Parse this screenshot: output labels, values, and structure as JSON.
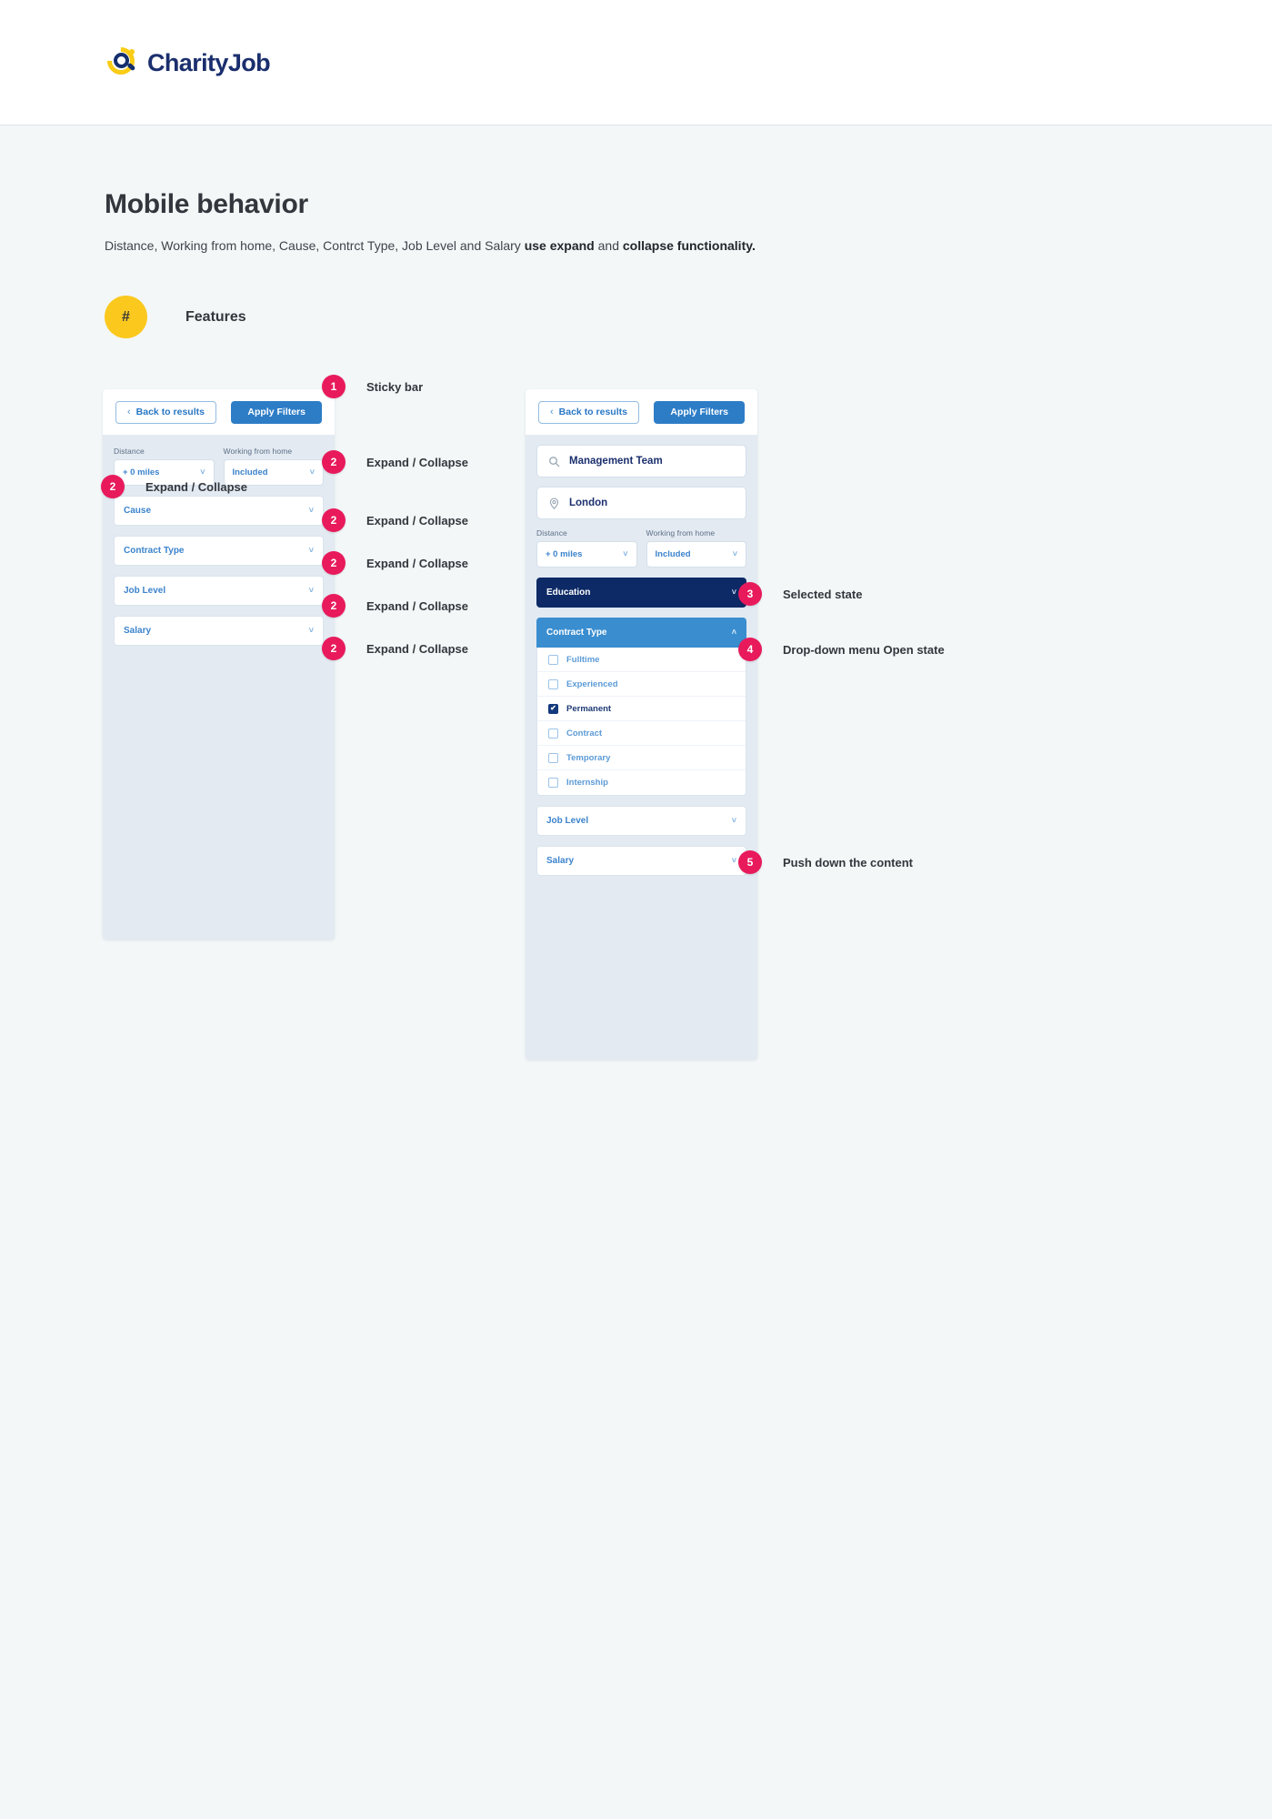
{
  "header": {
    "logo_text": "CharityJob",
    "logo_icon": "charityjob-magnifier-logo"
  },
  "title": "Mobile behavior",
  "subtitle": {
    "part1": "Distance, Working from home, Cause, Contrct Type, Job Level and Salary ",
    "bold1": "use expand",
    "part2": " and ",
    "bold2": "collapse functionality."
  },
  "features": {
    "hash": "#",
    "label": "Features"
  },
  "colors": {
    "page_bg": "#f3f7f8",
    "mock_bg": "#e3eaf2",
    "accent_pink": "#e81a5c",
    "brand_navy": "#0d2a66",
    "brand_blue": "#2d7dc6",
    "selected_blue": "#3a8ed0",
    "badge_yellow": "#fbc81e"
  },
  "sticky_bar": {
    "back_label": "Back to results",
    "back_icon": "chevron-left-icon",
    "apply_label": "Apply Filters"
  },
  "left_mock": {
    "distance": {
      "label": "Distance",
      "value": "+ 0 miles",
      "icon": "chevron-down-icon"
    },
    "wfh": {
      "label": "Working from home",
      "value": "Included",
      "icon": "chevron-down-icon"
    },
    "accordions": [
      {
        "label": "Cause",
        "icon": "chevron-down-icon"
      },
      {
        "label": "Contract Type",
        "icon": "chevron-down-icon"
      },
      {
        "label": "Job Level",
        "icon": "chevron-down-icon"
      },
      {
        "label": "Salary",
        "icon": "chevron-down-icon"
      }
    ],
    "overlay_label": "Expand / Collapse"
  },
  "right_mock": {
    "keyword": {
      "value": "Management Team",
      "icon": "search-icon"
    },
    "location": {
      "value": "London",
      "icon": "location-pin-icon"
    },
    "distance": {
      "label": "Distance",
      "value": "+ 0 miles",
      "icon": "chevron-down-icon"
    },
    "wfh": {
      "label": "Working from home",
      "value": "Included",
      "icon": "chevron-down-icon"
    },
    "education": {
      "label": "Education",
      "icon": "chevron-down-icon",
      "state": "selected"
    },
    "contract_type": {
      "label": "Contract Type",
      "icon": "chevron-up-icon",
      "state": "open"
    },
    "contract_options": [
      {
        "label": "Fulltime",
        "checked": false
      },
      {
        "label": "Experienced",
        "checked": false
      },
      {
        "label": "Permanent",
        "checked": true
      },
      {
        "label": "Contract",
        "checked": false
      },
      {
        "label": "Temporary",
        "checked": false
      },
      {
        "label": "Internship",
        "checked": false
      }
    ],
    "check_glyph": "✔",
    "accordions": [
      {
        "label": "Job Level",
        "icon": "chevron-down-icon"
      },
      {
        "label": "Salary",
        "icon": "chevron-down-icon"
      }
    ]
  },
  "annotations": [
    {
      "num": "1",
      "text": "Sticky bar"
    },
    {
      "num": "2",
      "text": "Expand / Collapse"
    },
    {
      "num": "2",
      "text": "Expand / Collapse"
    },
    {
      "num": "2",
      "text": "Expand / Collapse"
    },
    {
      "num": "2",
      "text": "Expand / Collapse"
    },
    {
      "num": "2",
      "text": "Expand / Collapse"
    },
    {
      "num": "3",
      "text": "Selected state"
    },
    {
      "num": "4",
      "text": "Drop-down menu Open state"
    },
    {
      "num": "5",
      "text": "Push down the content"
    }
  ]
}
